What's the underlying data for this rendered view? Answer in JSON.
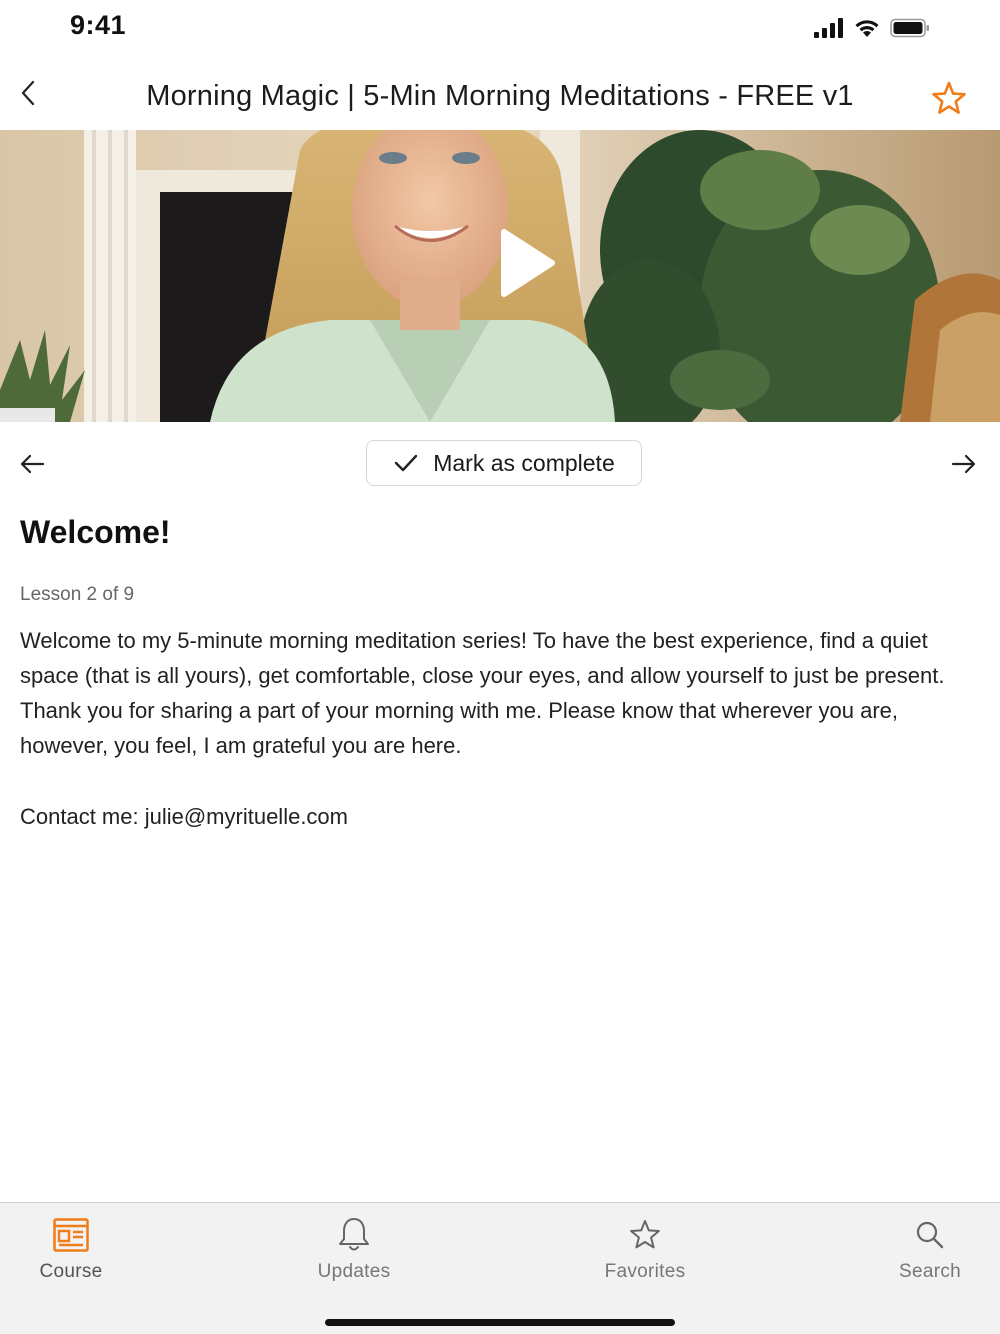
{
  "status_bar": {
    "time": "9:41",
    "icons": [
      "signal-icon",
      "wifi-icon",
      "battery-icon"
    ]
  },
  "header": {
    "title": "Morning Magic | 5-Min Morning Meditations - FREE v1",
    "back_icon": "chevron-left-icon",
    "favorite_icon": "star-outline-icon",
    "accent_color": "#F07D1A"
  },
  "video": {
    "play_icon": "play-icon"
  },
  "lesson_nav": {
    "prev_icon": "arrow-left-icon",
    "next_icon": "arrow-right-icon",
    "complete_label": "Mark as complete",
    "complete_icon": "checkmark-icon"
  },
  "lesson": {
    "title": "Welcome!",
    "meta": "Lesson 2 of 9",
    "body": "Welcome to my 5-minute morning meditation series! To have the best experience, find a quiet space (that is all yours), get comfortable, close your eyes, and allow yourself to just be present. Thank you for sharing a part of your morning with me. Please know that wherever you are, however, you feel, I am grateful you are here.",
    "contact": "Contact me: julie@myrituelle.com"
  },
  "tab_bar": {
    "active_color": "#F07D1A",
    "tabs": [
      {
        "label": "Course",
        "icon": "course-icon",
        "active": true
      },
      {
        "label": "Updates",
        "icon": "bell-icon",
        "active": false
      },
      {
        "label": "Favorites",
        "icon": "star-icon",
        "active": false
      },
      {
        "label": "Search",
        "icon": "search-icon",
        "active": false
      }
    ]
  }
}
